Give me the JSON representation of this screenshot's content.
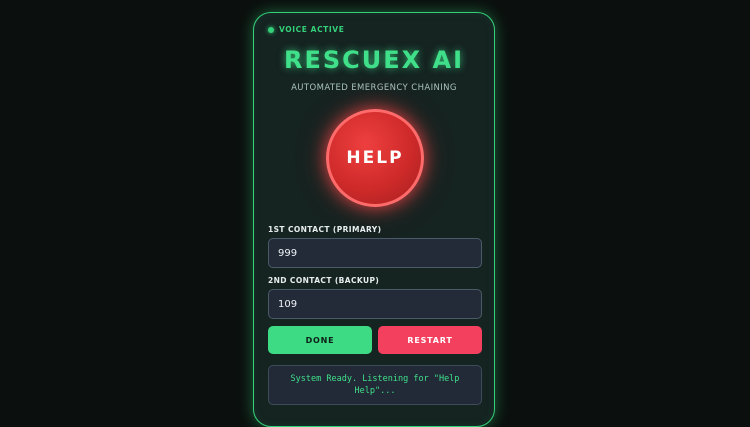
{
  "status_indicator": {
    "label": "VOICE ACTIVE",
    "color": "#34d07a"
  },
  "header": {
    "title": "RESCUEX AI",
    "subtitle": "AUTOMATED EMERGENCY CHAINING"
  },
  "help_button": {
    "label": "HELP",
    "color": "#cf2a2a"
  },
  "contacts": {
    "primary": {
      "label": "1ST CONTACT (PRIMARY)",
      "value": "999"
    },
    "backup": {
      "label": "2ND CONTACT (BACKUP)",
      "value": "109"
    }
  },
  "actions": {
    "done_label": "DONE",
    "restart_label": "RESTART",
    "done_color": "#3ddc84",
    "restart_color": "#f2405e"
  },
  "status": {
    "message": "System Ready. Listening for \"Help Help\"..."
  },
  "theme": {
    "accent": "#34d07a",
    "background": "#0b100e",
    "card": "#152321"
  }
}
